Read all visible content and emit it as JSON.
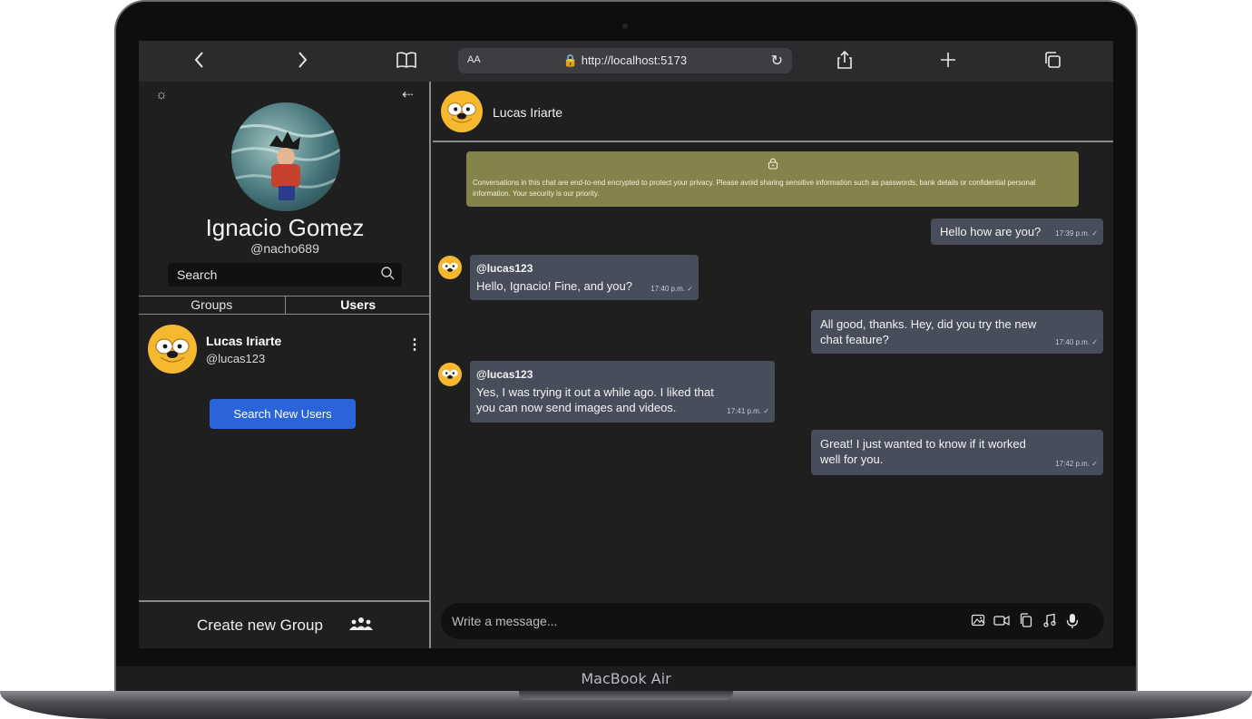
{
  "device": {
    "label": "MacBook Air"
  },
  "browser": {
    "back_icon": "chevron-left",
    "forward_icon": "chevron-right",
    "reader_text_size": "AA",
    "url": "http://localhost:5173"
  },
  "sidebar": {
    "profile_name": "Ignacio Gomez",
    "profile_handle": "@nacho689",
    "search_placeholder": "Search",
    "tabs": [
      {
        "label": "Groups",
        "active": false
      },
      {
        "label": "Users",
        "active": true
      }
    ],
    "users": [
      {
        "name": "Lucas Iriarte",
        "handle": "@lucas123"
      }
    ],
    "search_new_users_label": "Search New Users",
    "create_group_label": "Create new Group"
  },
  "chat": {
    "contact_name": "Lucas Iriarte",
    "encryption_notice": "Conversations in this chat are end-to-end encrypted to protect your privacy. Please avoid sharing sensitive information such as passwords, bank details or confidential personal information. Your security is our priority.",
    "messages": [
      {
        "from": "me",
        "text": "Hello how are you?",
        "time": "17:39 p.m."
      },
      {
        "from": "them",
        "sender": "@lucas123",
        "text": "Hello, Ignacio! Fine, and you?",
        "time": "17:40 p.m."
      },
      {
        "from": "me",
        "text": "All good, thanks. Hey, did you try the new chat feature?",
        "time": "17:40 p.m."
      },
      {
        "from": "them",
        "sender": "@lucas123",
        "text": "Yes, I was trying it out a while ago. I liked that you can now send images and videos.",
        "time": "17:41 p.m."
      },
      {
        "from": "me",
        "text": "Great! I just wanted to know if it worked well for you.",
        "time": "17:42 p.m."
      }
    ],
    "composer_placeholder": "Write a message..."
  },
  "colors": {
    "accent_button": "#2b63d9",
    "bubble": "#474d5b",
    "notice": "#86824b",
    "avatar_yellow": "#f5b82e"
  }
}
